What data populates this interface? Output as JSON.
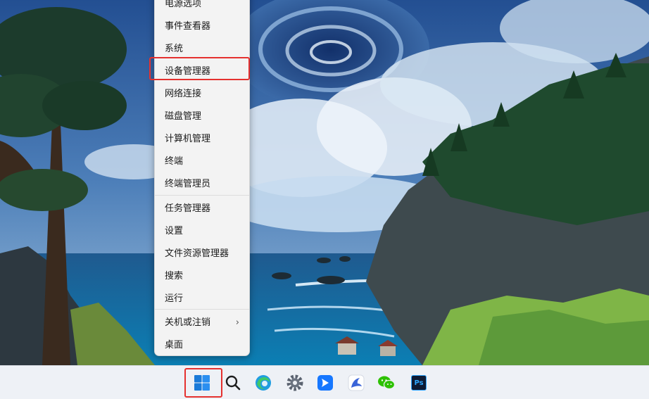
{
  "menu": {
    "items": [
      {
        "label": "电源选项",
        "has_submenu": false
      },
      {
        "label": "事件查看器",
        "has_submenu": false
      },
      {
        "label": "系统",
        "has_submenu": false
      },
      {
        "label": "设备管理器",
        "has_submenu": false,
        "highlighted": true
      },
      {
        "label": "网络连接",
        "has_submenu": false
      },
      {
        "label": "磁盘管理",
        "has_submenu": false
      },
      {
        "label": "计算机管理",
        "has_submenu": false
      },
      {
        "label": "终端",
        "has_submenu": false
      },
      {
        "label": "终端管理员",
        "has_submenu": false
      },
      {
        "label": "任务管理器",
        "has_submenu": false
      },
      {
        "label": "设置",
        "has_submenu": false
      },
      {
        "label": "文件资源管理器",
        "has_submenu": false
      },
      {
        "label": "搜索",
        "has_submenu": false
      },
      {
        "label": "运行",
        "has_submenu": false
      },
      {
        "label": "关机或注销",
        "has_submenu": true
      },
      {
        "label": "桌面",
        "has_submenu": false
      }
    ],
    "submenu_arrow": "›",
    "highlight_color": "#e5312f"
  },
  "taskbar": {
    "icons": [
      {
        "name": "windows-start-icon",
        "highlighted": true
      },
      {
        "name": "search-icon"
      },
      {
        "name": "edge-browser-icon"
      },
      {
        "name": "settings-gear-icon"
      },
      {
        "name": "feishu-bird-icon"
      },
      {
        "name": "mail-bird-icon"
      },
      {
        "name": "wechat-icon"
      },
      {
        "name": "photoshop-icon",
        "label": "Ps"
      }
    ]
  }
}
